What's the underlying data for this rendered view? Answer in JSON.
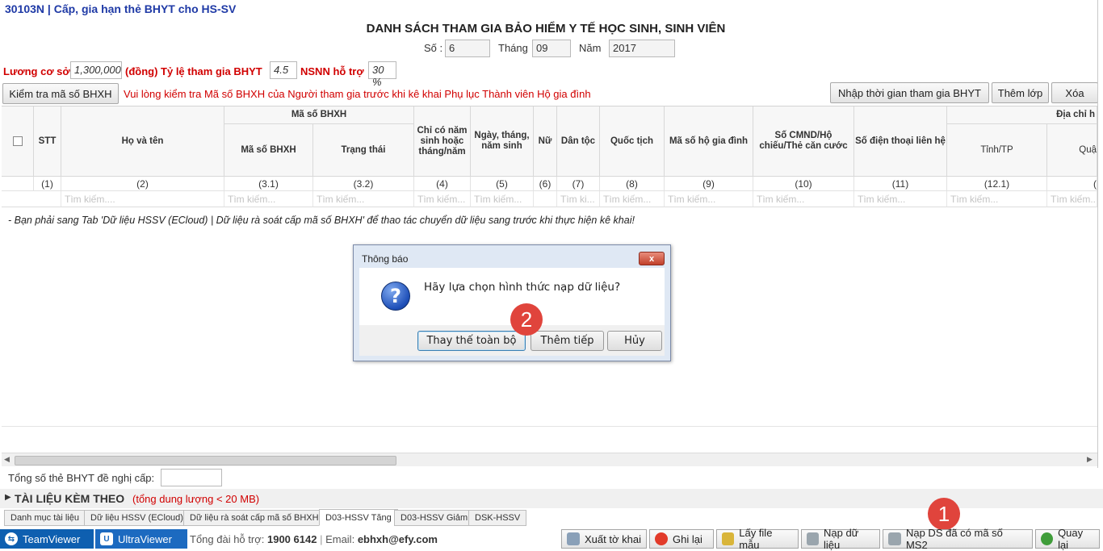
{
  "app_title": "30103N | Cấp, gia hạn thẻ BHYT cho HS-SV",
  "page_title": "DANH SÁCH THAM GIA BẢO HIỂM Y TẾ HỌC SINH, SINH VIÊN",
  "period": {
    "so_label": "Số :",
    "so_value": "6",
    "thang_label": "Tháng",
    "thang_value": "09",
    "nam_label": "Năm",
    "nam_value": "2017"
  },
  "params": {
    "luong_label": "Lương cơ sở",
    "luong_value": "1,300,000",
    "dong_label": "(đồng) Tỷ lệ tham gia BHYT",
    "ty_le_value": "4.5",
    "nsnn_label": "NSNN hỗ trợ",
    "nsnn_value": "30 %"
  },
  "toolbar": {
    "check_button": "Kiểm tra mã số BHXH",
    "warning": "Vui lòng kiểm tra Mã số BHXH của Người tham gia trước khi kê khai Phụ lục Thành viên Hộ gia đình",
    "nhap_button": "Nhập thời gian tham gia BHYT",
    "them_lop_button": "Thêm lớp",
    "xoa_button": "Xóa"
  },
  "grid": {
    "headers": {
      "stt": "STT",
      "ho_ten": "Họ và tên",
      "ma_so_group": "Mã số BHXH",
      "ma_so": "Mã số BHXH",
      "trang_thai": "Trạng thái",
      "chi_co_nam": "Chỉ có năm sinh hoặc tháng/năm",
      "ngay_sinh": "Ngày, tháng, năm sinh",
      "nu": "Nữ",
      "dan_toc": "Dân tộc",
      "quoc_tich": "Quốc tịch",
      "ma_ho": "Mã số hộ gia đình",
      "cmnd": "Số CMND/Hộ chiếu/Thẻ căn cước",
      "dien_thoai": "Số điện thoại liên hệ",
      "dia_chi_group": "Địa chỉ h",
      "tinh": "Tỉnh/TP",
      "quan": "Quậ"
    },
    "numbers": [
      "(1)",
      "(2)",
      "(3.1)",
      "(3.2)",
      "(4)",
      "(5)",
      "(6)",
      "(7)",
      "(8)",
      "(9)",
      "(10)",
      "(11)",
      "(12.1)",
      "("
    ],
    "search_placeholders": [
      "Tìm kiếm....",
      "Tìm kiếm...",
      "Tìm kiếm...",
      "Tìm kiếm...",
      "Tìm kiếm...",
      "Tìm ki...",
      "Tìm kiếm...",
      "Tìm kiếm...",
      "Tìm kiếm...",
      "Tìm kiếm...",
      "Tìm kiếm...",
      "Tìm kiếm..."
    ]
  },
  "note": "- Bạn phải sang Tab 'Dữ liệu HSSV (ECloud) | Dữ liệu rà soát cấp mã số BHXH' để thao tác chuyển dữ liệu sang trước khi thực hiện kê khai!",
  "dialog": {
    "title": "Thông báo",
    "message": "Hãy lựa chọn hình thức nạp dữ liệu?",
    "buttons": [
      "Thay thế toàn bộ",
      "Thêm tiếp",
      "Hủy"
    ],
    "close": "x"
  },
  "badges": [
    "2",
    "1"
  ],
  "total": {
    "label": "Tổng số thẻ BHYT đề nghị cấp:",
    "value": ""
  },
  "attachments": {
    "title": "TÀI LIỆU KÈM THEO",
    "note": "(tổng dung lượng < 20 MB)"
  },
  "tabs": [
    "Danh mục tài liệu",
    "Dữ liệu HSSV (ECloud)",
    "Dữ liệu rà soát cấp mã số BHXH",
    "D03-HSSV Tăng",
    "D03-HSSV Giảm",
    "DSK-HSSV"
  ],
  "footer": {
    "teamviewer": "TeamViewer",
    "ultraviewer": "UltraViewer",
    "support_label": "Tổng đài hỗ trợ:",
    "support_phone": "1900 6142",
    "email_label": "Email:",
    "email": "ebhxh@efy.com",
    "buttons": [
      "Xuất tờ khai",
      "Ghi lại",
      "Lấy file mẫu",
      "Nạp dữ liệu",
      "Nạp DS đã có mã số MS2",
      "Quay lại"
    ]
  },
  "colors": {
    "title_blue": "#1f3aa6",
    "warning_red": "#d10000",
    "badge_red": "#e0443c"
  }
}
